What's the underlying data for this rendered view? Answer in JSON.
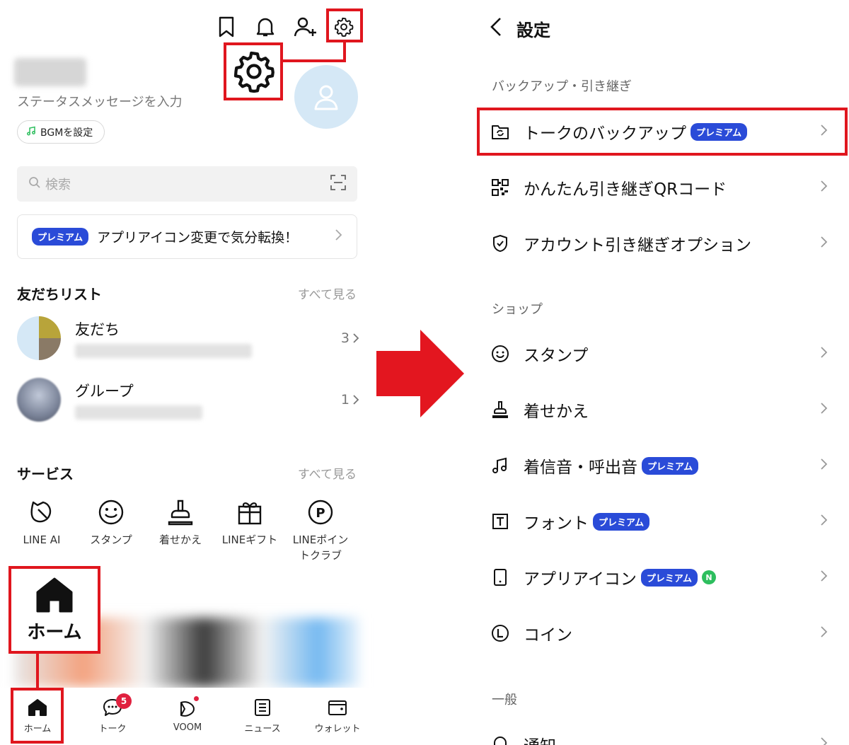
{
  "left": {
    "status_placeholder": "ステータスメッセージを入力",
    "bgm_label": "BGMを設定",
    "search_placeholder": "検索",
    "promo": {
      "badge": "プレミアム",
      "text": "アプリアイコン変更で気分転換！"
    },
    "friends_section": {
      "title": "友だちリスト",
      "see_all": "すべて見る"
    },
    "friends": [
      {
        "name": "友だち",
        "count": "3"
      },
      {
        "name": "グループ",
        "count": "1"
      }
    ],
    "services_section": {
      "title": "サービス",
      "see_all": "すべて見る"
    },
    "services": [
      {
        "label": "LINE AI",
        "icon": "line-ai-icon"
      },
      {
        "label": "スタンプ",
        "icon": "smiley-icon"
      },
      {
        "label": "着せかえ",
        "icon": "brush-icon"
      },
      {
        "label": "LINEギフト",
        "icon": "gift-icon"
      },
      {
        "label": "LINEポイントクラブ",
        "icon": "points-icon"
      }
    ],
    "home_callout": "ホーム",
    "nav": [
      {
        "label": "ホーム",
        "icon": "home-icon"
      },
      {
        "label": "トーク",
        "icon": "chat-icon",
        "badge": "5"
      },
      {
        "label": "VOOM",
        "icon": "voom-icon"
      },
      {
        "label": "ニュース",
        "icon": "news-icon"
      },
      {
        "label": "ウォレット",
        "icon": "wallet-icon"
      }
    ]
  },
  "right": {
    "title": "設定",
    "sections": [
      {
        "title": "バックアップ・引き継ぎ"
      },
      {
        "title": "ショップ"
      },
      {
        "title": "一般"
      }
    ],
    "rows": [
      {
        "label": "トークのバックアップ",
        "badge": "プレミアム",
        "icon": "backup-icon"
      },
      {
        "label": "かんたん引き継ぎQRコード",
        "icon": "qr-code-icon"
      },
      {
        "label": "アカウント引き継ぎオプション",
        "icon": "shield-icon"
      },
      {
        "label": "スタンプ",
        "icon": "smiley-icon"
      },
      {
        "label": "着せかえ",
        "icon": "brush-icon"
      },
      {
        "label": "着信音・呼出音",
        "badge": "プレミアム",
        "icon": "music-icon"
      },
      {
        "label": "フォント",
        "badge": "プレミアム",
        "icon": "font-icon"
      },
      {
        "label": "アプリアイコン",
        "badge": "プレミアム",
        "badge2": "N",
        "icon": "phone-icon"
      },
      {
        "label": "コイン",
        "icon": "coin-icon"
      },
      {
        "label": "通知",
        "icon": "bell-icon"
      }
    ]
  },
  "colors": {
    "highlight": "#e0161e",
    "premium": "#2a4bd8",
    "new_badge": "#2dbe5e",
    "arrow": "#e3161f"
  }
}
